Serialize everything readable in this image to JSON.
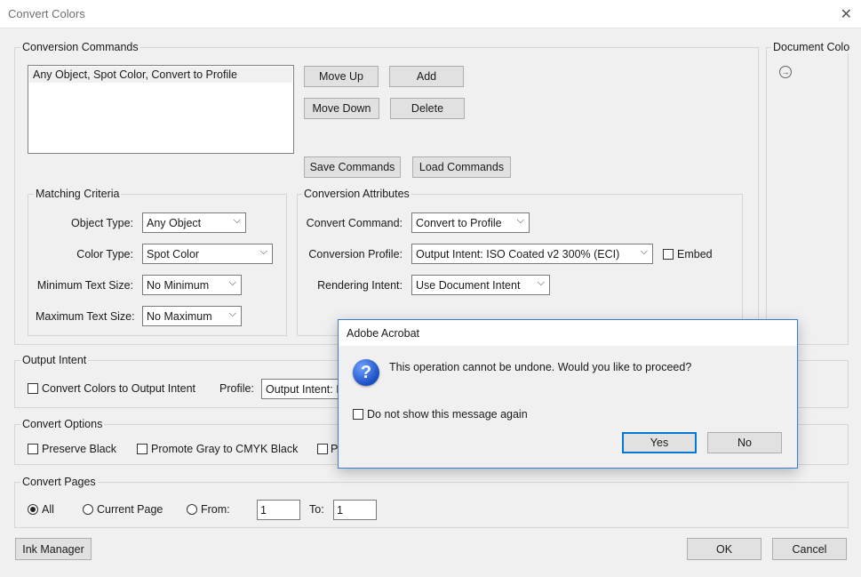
{
  "window": {
    "title": "Convert Colors",
    "close_glyph": "✕"
  },
  "conversion_commands": {
    "label": "Conversion Commands",
    "items": [
      "Any Object, Spot Color, Convert to Profile"
    ],
    "buttons": {
      "move_up": "Move Up",
      "add": "Add",
      "move_down": "Move Down",
      "delete": "Delete",
      "save": "Save Commands",
      "load": "Load Commands"
    }
  },
  "document_colors": {
    "label": "Document Colo",
    "icon": "arrow-right-circle-icon",
    "glyph": "→"
  },
  "matching_criteria": {
    "label": "Matching Criteria",
    "object_type": {
      "label": "Object Type:",
      "value": "Any Object"
    },
    "color_type": {
      "label": "Color Type:",
      "value": "Spot Color"
    },
    "min_text": {
      "label": "Minimum Text Size:",
      "value": "No Minimum"
    },
    "max_text": {
      "label": "Maximum Text Size:",
      "value": "No Maximum"
    }
  },
  "conversion_attributes": {
    "label": "Conversion Attributes",
    "convert_command": {
      "label": "Convert Command:",
      "value": "Convert to Profile"
    },
    "conversion_profile": {
      "label": "Conversion Profile:",
      "value": "Output Intent: ISO Coated v2 300% (ECI)"
    },
    "embed": {
      "label": "Embed",
      "checked": false
    },
    "rendering_intent": {
      "label": "Rendering Intent:",
      "value": "Use Document Intent"
    }
  },
  "output_intent": {
    "label": "Output Intent",
    "convert_checkbox": {
      "label": "Convert Colors to Output Intent",
      "checked": false
    },
    "profile": {
      "label": "Profile:",
      "value": "Output Intent: I"
    }
  },
  "convert_options": {
    "label": "Convert Options",
    "preserve_black": {
      "label": "Preserve Black",
      "checked": false
    },
    "promote_gray": {
      "label": "Promote Gray to CMYK Black",
      "checked": false
    },
    "third_option_partial": {
      "label": "P",
      "checked": false
    }
  },
  "convert_pages": {
    "label": "Convert Pages",
    "all": {
      "label": "All",
      "selected": true
    },
    "current_page": {
      "label": "Current Page",
      "selected": false
    },
    "from": {
      "label": "From:",
      "value": "1",
      "selected": false
    },
    "to": {
      "label": "To:",
      "value": "1"
    }
  },
  "footer": {
    "ink_manager": "Ink Manager",
    "ok": "OK",
    "cancel": "Cancel"
  },
  "alert": {
    "title": "Adobe Acrobat",
    "icon": "question-icon",
    "icon_glyph": "?",
    "message": "This operation cannot be undone. Would you like to proceed?",
    "dont_show": {
      "label": "Do not show this message again",
      "checked": false
    },
    "yes": "Yes",
    "no": "No"
  },
  "colors": {
    "accent": "#0078d7",
    "dialog_bg": "#f0f0f0",
    "button_bg": "#e1e1e1",
    "alert_border": "#3a7bd5"
  }
}
